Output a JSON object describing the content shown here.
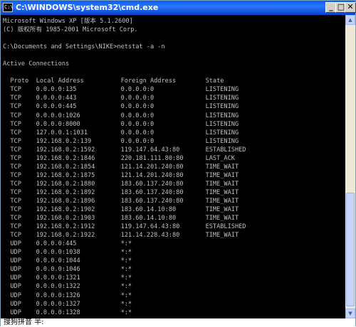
{
  "window": {
    "title": "C:\\WINDOWS\\system32\\cmd.exe",
    "icon_label": "C:\\",
    "buttons": {
      "minimize": "_",
      "maximize": "□",
      "close": "✕"
    }
  },
  "console": {
    "lines": [
      "Microsoft Windows XP [版本 5.1.2600]",
      "(C) 版权所有 1985-2001 Microsoft Corp.",
      "",
      "C:\\Documents and Settings\\NIKE>netstat -a -n",
      "",
      "Active Connections",
      "",
      "  Proto  Local Address          Foreign Address        State",
      "  TCP    0.0.0.0:135            0.0.0.0:0              LISTENING",
      "  TCP    0.0.0.0:443            0.0.0.0:0              LISTENING",
      "  TCP    0.0.0.0:445            0.0.0.0:0              LISTENING",
      "  TCP    0.0.0.0:1026           0.0.0.0:0              LISTENING",
      "  TCP    0.0.0.0:8000           0.0.0.0:0              LISTENING",
      "  TCP    127.0.0.1:1031         0.0.0.0:0              LISTENING",
      "  TCP    192.168.0.2:139        0.0.0.0:0              LISTENING",
      "  TCP    192.168.0.2:1592       119.147.64.43:80       ESTABLISHED",
      "  TCP    192.168.0.2:1846       220.181.111.80:80      LAST_ACK",
      "  TCP    192.168.0.2:1854       121.14.201.240:80      TIME_WAIT",
      "  TCP    192.168.0.2:1875       121.14.201.240:80      TIME_WAIT",
      "  TCP    192.168.0.2:1880       183.60.137.240:80      TIME_WAIT",
      "  TCP    192.168.0.2:1892       183.60.137.240:80      TIME_WAIT",
      "  TCP    192.168.0.2:1896       183.60.137.240:80      TIME_WAIT",
      "  TCP    192.168.0.2:1902       183.60.14.10:80        TIME_WAIT",
      "  TCP    192.168.0.2:1903       183.60.14.10:80        TIME_WAIT",
      "  TCP    192.168.0.2:1912       119.147.64.43:80       ESTABLISHED",
      "  TCP    192.168.0.2:1922       121.14.228.43:80       TIME_WAIT",
      "  UDP    0.0.0.0:445            *:*",
      "  UDP    0.0.0.0:1038           *:*",
      "  UDP    0.0.0.0:1044           *:*",
      "  UDP    0.0.0.0:1046           *:*",
      "  UDP    0.0.0.0:1321           *:*",
      "  UDP    0.0.0.0:1322           *:*",
      "  UDP    0.0.0.0:1326           *:*",
      "  UDP    0.0.0.0:1327           *:*",
      "  UDP    0.0.0.0:1328           *:*"
    ]
  },
  "ime_status": "搜狗拼音 半:"
}
